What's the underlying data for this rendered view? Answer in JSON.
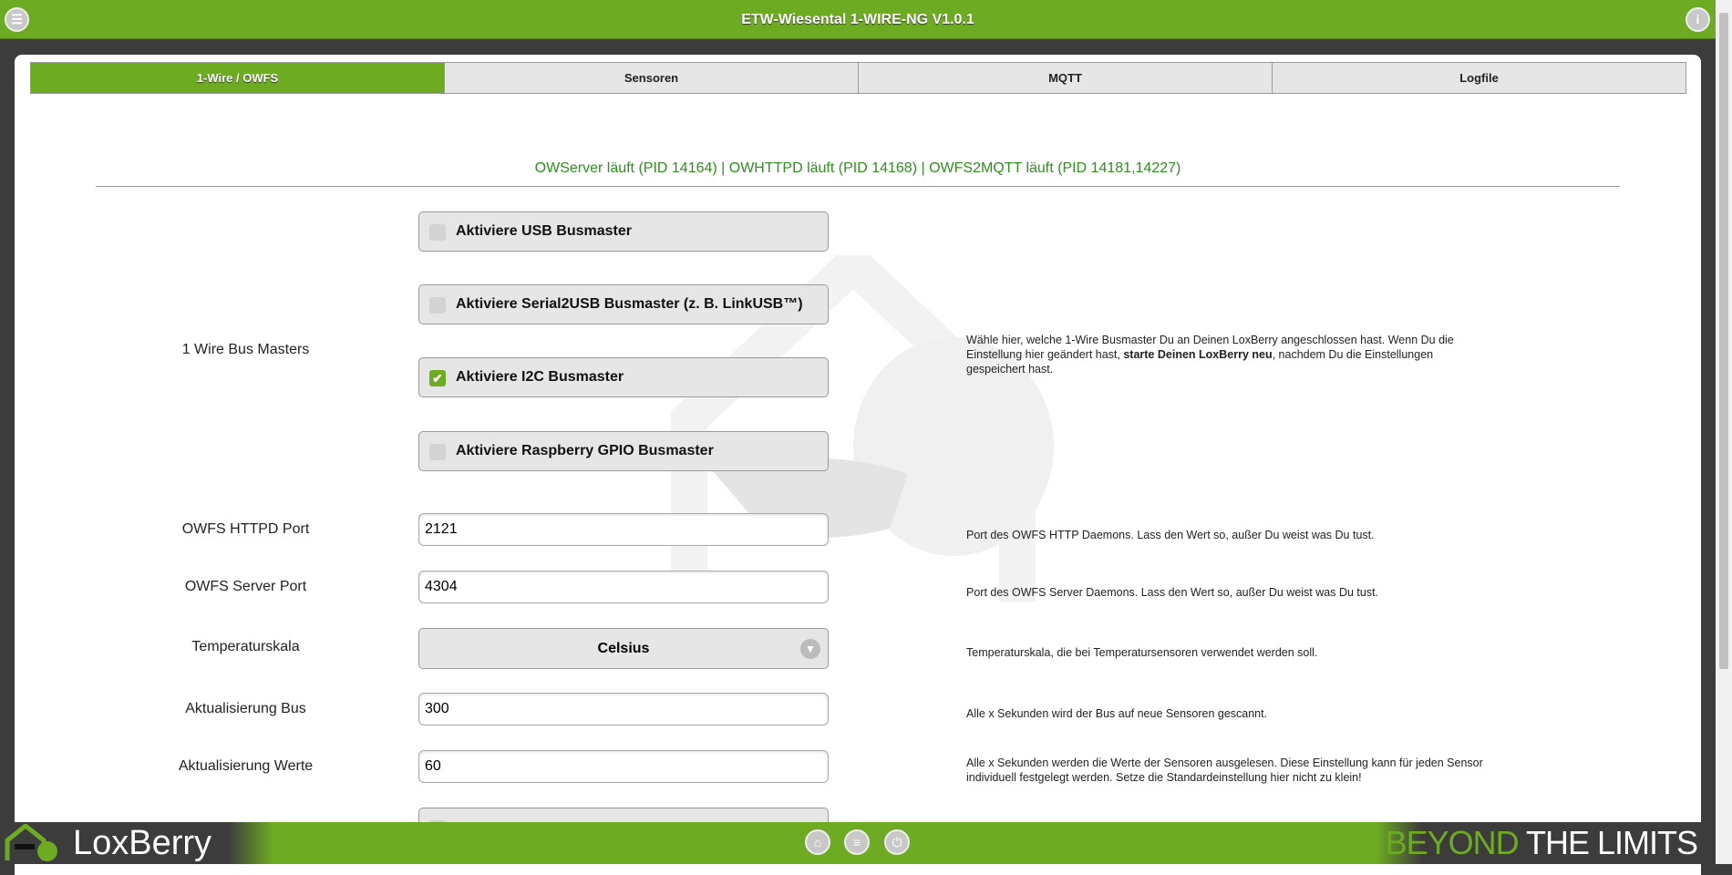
{
  "header": {
    "title": "ETW-Wiesental 1-WIRE-NG V1.0.1"
  },
  "tabs": [
    "1-Wire / OWFS",
    "Sensoren",
    "MQTT",
    "Logfile"
  ],
  "status": "OWServer läuft (PID 14164) | OWHTTPD läuft (PID 14168) | OWFS2MQTT läuft (PID 14181,14227)",
  "busmasters": {
    "label": "1 Wire Bus Masters",
    "options": [
      {
        "label": "Aktiviere USB Busmaster",
        "checked": false
      },
      {
        "label": "Aktiviere Serial2USB Busmaster (z. B. LinkUSB™)",
        "checked": false
      },
      {
        "label": "Aktiviere I2C Busmaster",
        "checked": true
      },
      {
        "label": "Aktiviere Raspberry GPIO Busmaster",
        "checked": false
      }
    ],
    "desc_a": "Wähle hier, welche 1-Wire Busmaster Du an Deinen LoxBerry angeschlossen hast. Wenn Du die Einstellung hier geändert hast, ",
    "desc_b": "starte Deinen LoxBerry neu",
    "desc_c": ", nachdem Du die Einstellungen gespeichert hast."
  },
  "fields": {
    "httpd": {
      "label": "OWFS HTTPD Port",
      "value": "2121",
      "desc": "Port des OWFS HTTP Daemons. Lass den Wert so, außer Du weist was Du tust."
    },
    "server": {
      "label": "OWFS Server Port",
      "value": "4304",
      "desc": "Port des OWFS Server Daemons. Lass den Wert so, außer Du weist was Du tust."
    },
    "scale": {
      "label": "Temperaturskala",
      "value": "Celsius",
      "desc": "Temperaturskala, die bei Temperatursensoren verwendet werden soll."
    },
    "bus": {
      "label": "Aktualisierung Bus",
      "value": "300",
      "desc": "Alle x Sekunden wird der Bus auf neue Sensoren gescannt."
    },
    "values": {
      "label": "Aktualisierung Werte",
      "value": "60",
      "desc": "Alle x Sekunden werden die Werte der Sensoren ausgelesen. Diese Einstellung kann für jeden Sensor individuell festgelegt werden. Setze die Standardeinstellung hier nicht zu klein!"
    }
  },
  "footer": {
    "logo": "LoxBerry",
    "slogan_a": "BEYOND",
    "slogan_b": " THE LIMITS"
  }
}
